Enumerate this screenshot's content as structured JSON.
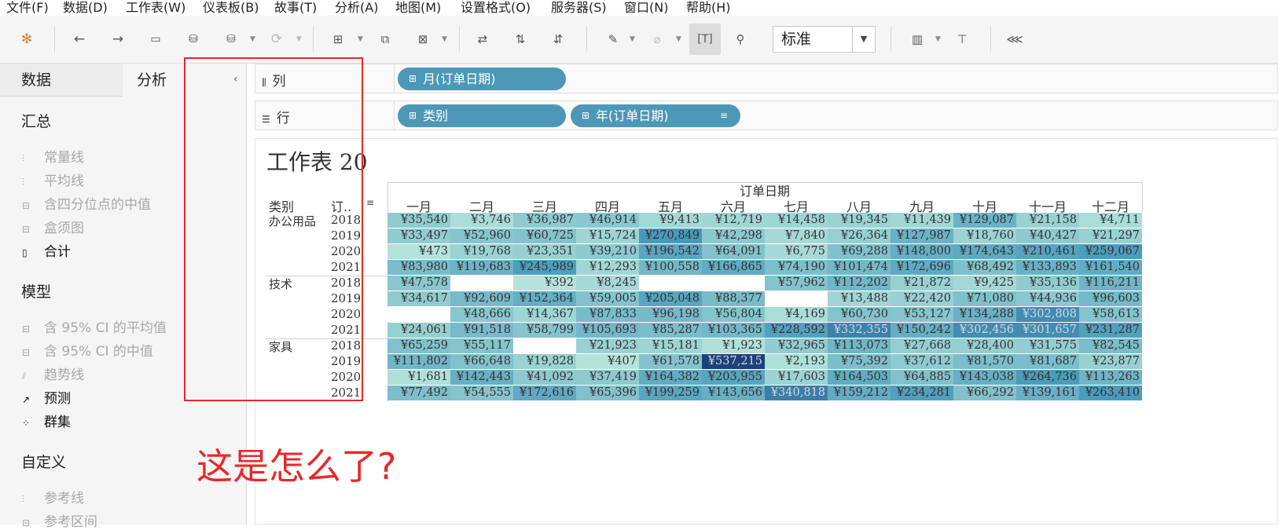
{
  "menu": [
    "文件(F)",
    "数据(D)",
    "工作表(W)",
    "仪表板(B)",
    "故事(T)",
    "分析(A)",
    "地图(M)",
    "设置格式(O)",
    "服务器(S)",
    "窗口(N)",
    "帮助(H)"
  ],
  "toolbar": {
    "fit_select": "标准",
    "icons": [
      "tableau-logo-icon",
      "undo-icon",
      "redo-icon",
      "save-icon",
      "new-datasource-icon",
      "pause-updates-icon",
      "refresh-icon",
      "new-worksheet-icon",
      "duplicate-sheet-icon",
      "clear-sheet-icon",
      "swap-rows-columns-icon",
      "sort-ascending-icon",
      "sort-descending-icon",
      "highlight-icon",
      "group-icon",
      "show-mark-labels-icon",
      "fix-axes-icon",
      "show-me-icon",
      "presentation-icon",
      "share-icon"
    ]
  },
  "left_pane": {
    "tabs": [
      "数据",
      "分析"
    ],
    "active_tab": "分析",
    "sections": [
      {
        "title": "汇总",
        "items": [
          {
            "label": "常量线",
            "enabled": false
          },
          {
            "label": "平均线",
            "enabled": false
          },
          {
            "label": "含四分位点的中值",
            "enabled": false
          },
          {
            "label": "盒须图",
            "enabled": false
          },
          {
            "label": "合计",
            "enabled": true
          }
        ]
      },
      {
        "title": "模型",
        "items": [
          {
            "label": "含 95% CI 的平均值",
            "enabled": false
          },
          {
            "label": "含 95% CI 的中值",
            "enabled": false
          },
          {
            "label": "趋势线",
            "enabled": false
          },
          {
            "label": "预测",
            "enabled": true
          },
          {
            "label": "群集",
            "enabled": true
          }
        ]
      },
      {
        "title": "自定义",
        "items": [
          {
            "label": "参考线",
            "enabled": false
          },
          {
            "label": "参考区间",
            "enabled": false
          }
        ]
      }
    ]
  },
  "shelves": {
    "columns_label": "列",
    "rows_label": "行",
    "columns_pills": [
      "月(订单日期)"
    ],
    "rows_pills": [
      "类别",
      "年(订单日期)"
    ]
  },
  "worksheet": {
    "title": "工作表 20",
    "top_header": "订单日期",
    "row_header_category": "类别",
    "row_header_year": "订..",
    "months": [
      "一月",
      "二月",
      "三月",
      "四月",
      "五月",
      "六月",
      "七月",
      "八月",
      "九月",
      "十月",
      "十一月",
      "十二月"
    ],
    "groups": [
      {
        "category": "办公用品",
        "rows": [
          {
            "year": "2018",
            "values": [
              "¥35,540",
              "¥3,746",
              "¥36,987",
              "¥46,914",
              "¥9,413",
              "¥12,719",
              "¥14,458",
              "¥19,345",
              "¥11,439",
              "¥129,087",
              "¥21,158",
              "¥4,711"
            ]
          },
          {
            "year": "2019",
            "values": [
              "¥33,497",
              "¥52,960",
              "¥60,725",
              "¥15,724",
              "¥270,849",
              "¥42,298",
              "¥7,840",
              "¥26,364",
              "¥127,987",
              "¥18,760",
              "¥40,427",
              "¥21,297"
            ]
          },
          {
            "year": "2020",
            "values": [
              "¥473",
              "¥19,768",
              "¥23,351",
              "¥39,210",
              "¥196,542",
              "¥64,091",
              "¥6,775",
              "¥69,288",
              "¥148,800",
              "¥174,643",
              "¥210,461",
              "¥259,067"
            ]
          },
          {
            "year": "2021",
            "values": [
              "¥83,980",
              "¥119,683",
              "¥245,989",
              "¥12,293",
              "¥100,558",
              "¥166,865",
              "¥74,190",
              "¥101,474",
              "¥172,696",
              "¥68,492",
              "¥133,893",
              "¥161,540"
            ]
          }
        ]
      },
      {
        "category": "技术",
        "rows": [
          {
            "year": "2018",
            "values": [
              "¥47,578",
              "",
              "¥392",
              "¥8,245",
              "",
              "",
              "¥57,962",
              "¥112,202",
              "¥21,872",
              "¥9,425",
              "¥35,136",
              "¥116,211"
            ]
          },
          {
            "year": "2019",
            "values": [
              "¥34,617",
              "¥92,609",
              "¥152,364",
              "¥59,005",
              "¥205,048",
              "¥88,377",
              "",
              "¥13,488",
              "¥22,420",
              "¥71,080",
              "¥44,936",
              "¥96,603"
            ]
          },
          {
            "year": "2020",
            "values": [
              "",
              "¥48,666",
              "¥14,367",
              "¥87,833",
              "¥96,198",
              "¥56,804",
              "¥4,169",
              "¥60,730",
              "¥53,127",
              "¥134,288",
              "¥302,808",
              "¥58,613"
            ]
          },
          {
            "year": "2021",
            "values": [
              "¥24,061",
              "¥91,518",
              "¥58,799",
              "¥105,693",
              "¥85,287",
              "¥103,365",
              "¥228,592",
              "¥332,355",
              "¥150,242",
              "¥302,456",
              "¥301,657",
              "¥231,287"
            ]
          }
        ]
      },
      {
        "category": "家具",
        "rows": [
          {
            "year": "2018",
            "values": [
              "¥65,259",
              "¥55,117",
              "",
              "¥21,923",
              "¥15,181",
              "¥1,923",
              "¥32,965",
              "¥113,073",
              "¥27,668",
              "¥28,400",
              "¥31,575",
              "¥82,545"
            ]
          },
          {
            "year": "2019",
            "values": [
              "¥111,802",
              "¥66,648",
              "¥19,828",
              "¥407",
              "¥61,578",
              "¥537,215",
              "¥2,193",
              "¥75,392",
              "¥37,612",
              "¥81,570",
              "¥81,687",
              "¥23,877"
            ]
          },
          {
            "year": "2020",
            "values": [
              "¥1,681",
              "¥142,443",
              "¥41,092",
              "¥37,419",
              "¥164,382",
              "¥203,955",
              "¥17,603",
              "¥164,503",
              "¥64,885",
              "¥143,038",
              "¥264,736",
              "¥113,263"
            ]
          },
          {
            "year": "2021",
            "values": [
              "¥77,492",
              "¥54,555",
              "¥172,616",
              "¥65,396",
              "¥199,259",
              "¥143,656",
              "¥340,818",
              "¥159,212",
              "¥234,281",
              "¥66,292",
              "¥139,161",
              "¥263,410"
            ]
          }
        ]
      }
    ],
    "color_scale": {
      "min_value": 0,
      "max_value": 537215,
      "low_color": "#b9e6dc",
      "high_color": "#1f3f7a",
      "mid_color": "#4a9cbc"
    }
  },
  "annotation": {
    "question": "这是怎么了?",
    "color": "#e8282a"
  }
}
